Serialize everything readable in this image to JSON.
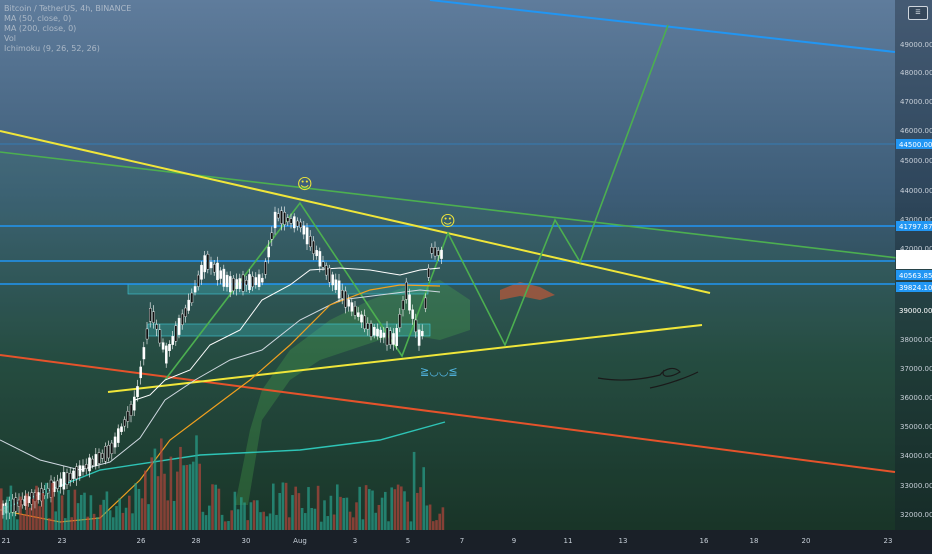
{
  "legend": {
    "title": "Bitcoin / TetherUS, 4h, BINANCE",
    "ma50": "MA (50, close, 0)",
    "ma200": "MA (200, close, 0)",
    "vol": "Vol",
    "ichimoku": "Ichimoku (9, 26, 52, 26)"
  },
  "menu_icon": "hamburger-menu-icon",
  "x_labels": [
    "21",
    "23",
    "26",
    "28",
    "30",
    "Aug",
    "3",
    "5",
    "7",
    "9",
    "11",
    "13",
    "16",
    "18",
    "20",
    "23"
  ],
  "y_ticks": [
    "49000.00",
    "48000.00",
    "47000.00",
    "46000.00",
    "45000.00",
    "44000.00",
    "43000.00",
    "42000.00",
    "41000.00",
    "38000.00",
    "37000.00",
    "36000.00",
    "35000.00",
    "34000.00",
    "33000.00",
    "32000.00"
  ],
  "price_tags": [
    {
      "text": "44500.00",
      "color": "#2196f3"
    },
    {
      "text": "41797.87",
      "color": "#2196f3"
    },
    {
      "text": "40785.79",
      "color": "#ffffff"
    },
    {
      "text": "03:27:22",
      "color": "#ffffff"
    },
    {
      "text": "40563.85",
      "color": "#2196f3"
    },
    {
      "text": "39824.10",
      "color": "#2196f3"
    },
    {
      "text": "39000.00",
      "color": "#c7cfd8"
    }
  ],
  "annotations": {
    "smiley1": "☺",
    "smiley2": "☺",
    "kaomoji": "≧◡◡≦"
  },
  "colors": {
    "yellow_trend": "#f0e63a",
    "green_channel": "#4caf50",
    "blue_level": "#2196f3",
    "red_trend": "#e5532b",
    "ma50": "#f0a01f",
    "ma200": "#2ec4b6"
  }
}
